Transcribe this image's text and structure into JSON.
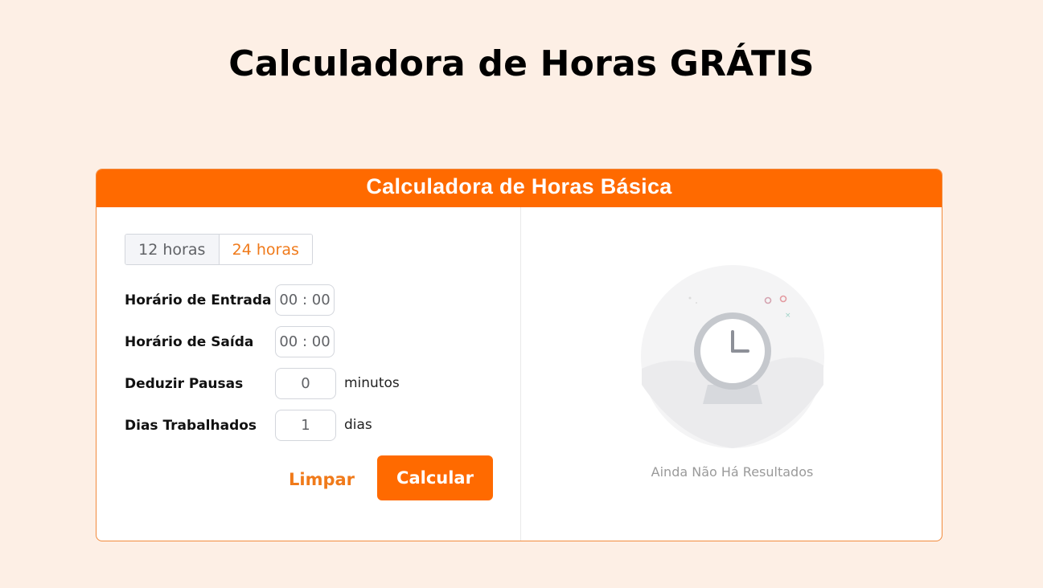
{
  "page": {
    "title": "Calculadora de Horas GRÁTIS"
  },
  "card": {
    "header": "Calculadora de Horas Básica"
  },
  "format_toggle": {
    "option_12": "12 horas",
    "option_24": "24 horas",
    "selected": "24 horas"
  },
  "form": {
    "entry_label": "Horário de Entrada",
    "entry_value": "00 : 00",
    "exit_label": "Horário de Saída",
    "exit_value": "00 : 00",
    "breaks_label": "Deduzir Pausas",
    "breaks_value": "0",
    "breaks_unit": "minutos",
    "days_label": "Dias Trabalhados",
    "days_value": "1",
    "days_unit": "dias"
  },
  "actions": {
    "clear_label": "Limpar",
    "calculate_label": "Calcular"
  },
  "results": {
    "empty_text": "Ainda Não Há Resultados",
    "illustration_icon": "clock-icon"
  },
  "colors": {
    "accent": "#ff6a00",
    "background": "#fdefe5",
    "border": "#f28a3c"
  }
}
